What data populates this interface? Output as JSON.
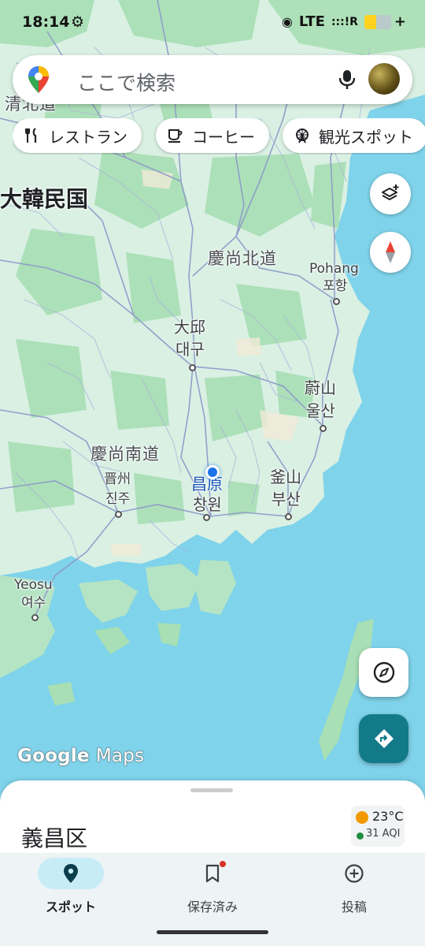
{
  "status_bar": {
    "time": "18:14",
    "network": "LTE",
    "signal": ":::!R",
    "battery_level": 0.45,
    "charging_symbol": "+"
  },
  "search": {
    "placeholder": "ここで検索"
  },
  "chips": [
    {
      "label": "レストラン",
      "icon": "fork-knife-icon"
    },
    {
      "label": "コーヒー",
      "icon": "coffee-cup-icon"
    },
    {
      "label": "観光スポット",
      "icon": "ferris-wheel-icon"
    }
  ],
  "map": {
    "labels": {
      "chungcheong": "清北道",
      "country": "大韓民国",
      "gyeongbuk": "慶尚北道",
      "pohang_en": "Pohang",
      "pohang_ko": "포항",
      "daegu_cn": "大邱",
      "daegu_ko": "대구",
      "ulsan_cn": "蔚山",
      "ulsan_ko": "울산",
      "gyeongnam": "慶尚南道",
      "jinju_cn": "晋州",
      "jinju_ko": "진주",
      "changwon_cn": "昌原",
      "changwon_ko": "창원",
      "busan_cn": "釜山",
      "busan_ko": "부산",
      "yeosu_en": "Yeosu",
      "yeosu_ko": "여수"
    },
    "attribution_brand": "Google",
    "attribution_product": "Maps",
    "colors": {
      "water": "#7fd3ea",
      "land": "#d9f0e3",
      "forest": "#a8dfb4",
      "roads": "#8d97c9",
      "user_location": "#1a73e8",
      "directions_button": "#137a8a"
    }
  },
  "sheet": {
    "place_name": "義昌区",
    "temperature": "23°C",
    "aqi": "31 AQI"
  },
  "bottom_nav": {
    "items": [
      {
        "label": "スポット",
        "icon": "location-pin-icon",
        "active": true
      },
      {
        "label": "保存済み",
        "icon": "bookmark-icon",
        "active": false
      },
      {
        "label": "投稿",
        "icon": "add-circle-icon",
        "active": false
      }
    ]
  }
}
